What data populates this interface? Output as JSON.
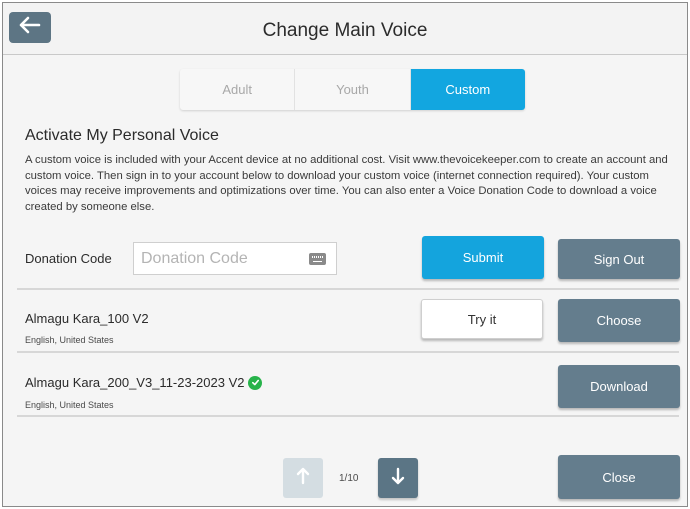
{
  "header": {
    "title": "Change Main Voice",
    "back_icon": "back-arrow-icon"
  },
  "tabs": [
    {
      "label": "Adult",
      "active": false
    },
    {
      "label": "Youth",
      "active": false
    },
    {
      "label": "Custom",
      "active": true
    }
  ],
  "section": {
    "heading": "Activate My Personal Voice",
    "description": "A custom voice is included with your Accent device at no additional cost. Visit www.thevoicekeeper.com to create an account and custom voice. Then sign in to your account below to download your custom voice (internet connection required). Your custom voices may receive improvements and optimizations over time. You can also enter a Voice Donation Code to download a voice created by someone else."
  },
  "donation": {
    "label": "Donation Code",
    "value": "",
    "placeholder": "Donation Code",
    "submit_label": "Submit",
    "signout_label": "Sign Out"
  },
  "voices": [
    {
      "name": "Almagu Kara_100 V2",
      "language": "English, United States",
      "try_label": "Try it",
      "action_label": "Choose",
      "verified": false
    },
    {
      "name": "Almagu Kara_200_V3_11-23-2023 V2",
      "language": "English, United States",
      "action_label": "Download",
      "verified": true
    }
  ],
  "pager": {
    "indicator": "1/10",
    "close_label": "Close"
  },
  "colors": {
    "accent_blue": "#14a4dd",
    "slate": "#647d8d",
    "verified_green": "#27b34a"
  }
}
